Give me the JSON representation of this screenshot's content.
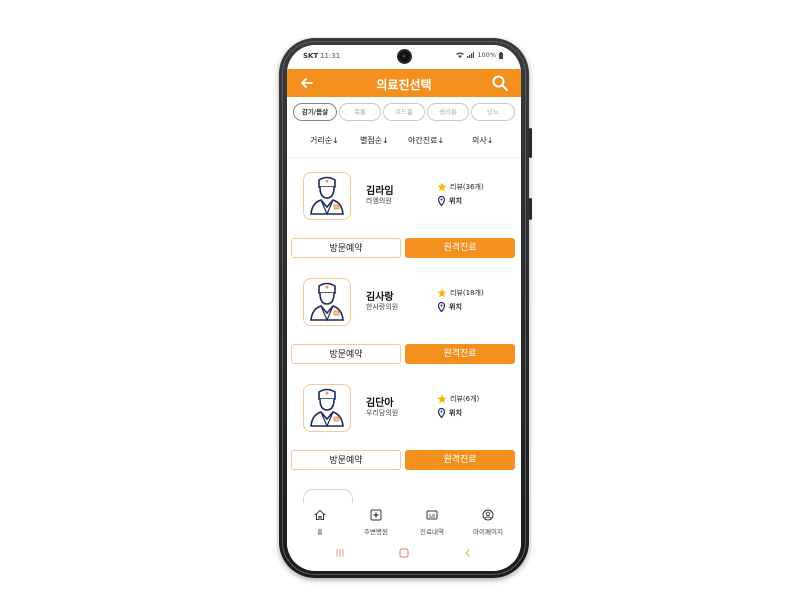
{
  "status_bar": {
    "carrier": "SKT",
    "time": "11:31",
    "battery": "100%"
  },
  "header": {
    "title": "의료진선택"
  },
  "filters": [
    "감기/몸살",
    "복통",
    "여드름",
    "생리통",
    "당뇨"
  ],
  "sort_options": [
    "거리순↓",
    "별점순↓",
    "야간진료↓",
    "의사↓"
  ],
  "doctors": [
    {
      "name": "김라임",
      "clinic": "라엠의원",
      "reviews": "리뷰(36개)",
      "location": "위치"
    },
    {
      "name": "김사랑",
      "clinic": "한사랑의원",
      "reviews": "리뷰(18개)",
      "location": "위치"
    },
    {
      "name": "김단아",
      "clinic": "우리담의원",
      "reviews": "리뷰(6개)",
      "location": "위치"
    }
  ],
  "buttons": {
    "visit": "방문예약",
    "remote": "원격진료"
  },
  "bottom_nav": [
    {
      "label": "홈",
      "icon": "home-icon"
    },
    {
      "label": "주변병원",
      "icon": "hospital-icon"
    },
    {
      "label": "진료내역",
      "icon": "history-icon"
    },
    {
      "label": "마이페이지",
      "icon": "user-icon"
    }
  ],
  "colors": {
    "accent": "#f3901d",
    "accent_light": "#f3c89b",
    "star": "#f5b800",
    "navy": "#1e2a5a"
  }
}
